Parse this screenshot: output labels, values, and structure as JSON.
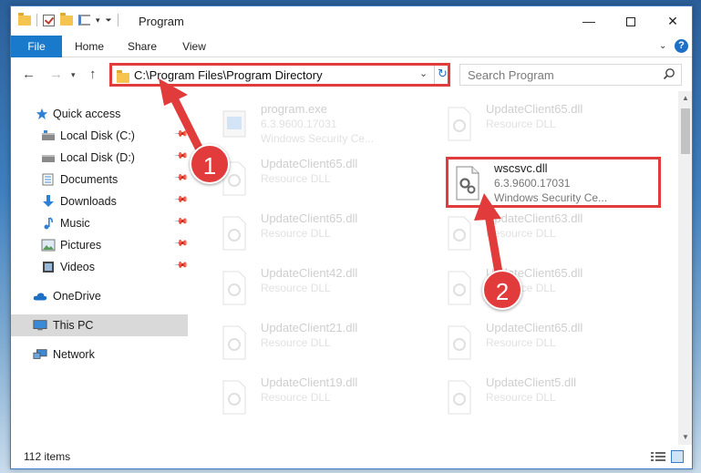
{
  "window": {
    "title": "Program"
  },
  "ribbon": {
    "tabs": [
      "File",
      "Home",
      "Share",
      "View"
    ]
  },
  "address": {
    "path": "C:\\Program Files\\Program Directory"
  },
  "search": {
    "placeholder": "Search Program"
  },
  "sidebar": {
    "items": [
      {
        "label": "Quick access",
        "icon": "star-icon"
      },
      {
        "label": "Local Disk (C:)",
        "icon": "drive-icon",
        "pinned": true
      },
      {
        "label": "Local Disk (D:)",
        "icon": "drive-icon",
        "pinned": true
      },
      {
        "label": "Documents",
        "icon": "documents-icon",
        "pinned": true
      },
      {
        "label": "Downloads",
        "icon": "download-icon",
        "pinned": true
      },
      {
        "label": "Music",
        "icon": "music-icon",
        "pinned": true
      },
      {
        "label": "Pictures",
        "icon": "pictures-icon",
        "pinned": true
      },
      {
        "label": "Videos",
        "icon": "videos-icon",
        "pinned": true
      },
      {
        "label": "OneDrive",
        "icon": "cloud-icon"
      },
      {
        "label": "This PC",
        "icon": "computer-icon",
        "selected": true
      },
      {
        "label": "Network",
        "icon": "network-icon"
      }
    ]
  },
  "files": [
    {
      "name": "program.exe",
      "ver": "6.3.9600.17031",
      "desc": "Windows Security Ce...",
      "faded": true,
      "icon": "exe-icon"
    },
    {
      "name": "UpdateClient65.dll",
      "ver": "Resource DLL",
      "desc": "",
      "faded": true,
      "icon": "dll-icon"
    },
    {
      "name": "UpdateClient65.dll",
      "ver": "Resource DLL",
      "desc": "",
      "faded": true,
      "icon": "dll-icon"
    },
    {
      "name": "wscsvc.dll",
      "ver": "6.3.9600.17031",
      "desc": "Windows Security Ce...",
      "faded": false,
      "highlight": true,
      "icon": "dll-gear-icon"
    },
    {
      "name": "UpdateClient65.dll",
      "ver": "Resource DLL",
      "desc": "",
      "faded": true,
      "icon": "dll-icon"
    },
    {
      "name": "UpdateClient63.dll",
      "ver": "Resource DLL",
      "desc": "",
      "faded": true,
      "icon": "dll-icon"
    },
    {
      "name": "UpdateClient42.dll",
      "ver": "Resource DLL",
      "desc": "",
      "faded": true,
      "icon": "dll-icon"
    },
    {
      "name": "UpdateClient65.dll",
      "ver": "Resource DLL",
      "desc": "",
      "faded": true,
      "icon": "dll-icon"
    },
    {
      "name": "UpdateClient21.dll",
      "ver": "Resource DLL",
      "desc": "",
      "faded": true,
      "icon": "dll-icon"
    },
    {
      "name": "UpdateClient65.dll",
      "ver": "Resource DLL",
      "desc": "",
      "faded": true,
      "icon": "dll-icon"
    },
    {
      "name": "UpdateClient19.dll",
      "ver": "Resource DLL",
      "desc": "",
      "faded": true,
      "icon": "dll-icon"
    },
    {
      "name": "UpdateClient5.dll",
      "ver": "Resource DLL",
      "desc": "",
      "faded": true,
      "icon": "dll-icon"
    }
  ],
  "status": {
    "count": "112 items"
  },
  "annotations": {
    "badge_1": "1",
    "badge_2": "2",
    "color": "#e23b3b"
  },
  "colors": {
    "accent": "#1979ca",
    "highlight_border": "#e03c3c"
  }
}
